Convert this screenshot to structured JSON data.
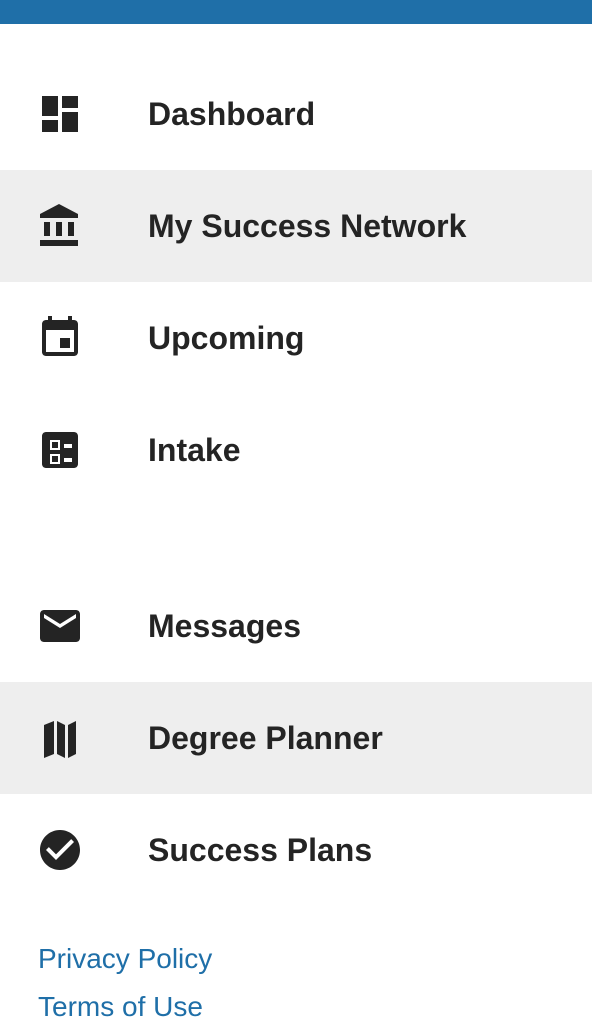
{
  "colors": {
    "top_bar": "#1f6fa8",
    "text": "#242424",
    "highlight_bg": "#eeeeee",
    "link": "#1f6fa8"
  },
  "nav": {
    "items": [
      {
        "label": "Dashboard",
        "icon": "dashboard-icon"
      },
      {
        "label": "My Success Network",
        "icon": "institution-icon",
        "highlighted": true
      },
      {
        "label": "Upcoming",
        "icon": "calendar-icon"
      },
      {
        "label": "Intake",
        "icon": "checklist-icon"
      },
      {
        "label": "Messages",
        "icon": "mail-icon"
      },
      {
        "label": "Degree Planner",
        "icon": "map-icon",
        "highlighted": true
      },
      {
        "label": "Success Plans",
        "icon": "check-circle-icon"
      }
    ]
  },
  "footer": {
    "privacy_label": "Privacy Policy",
    "terms_label": "Terms of Use"
  }
}
